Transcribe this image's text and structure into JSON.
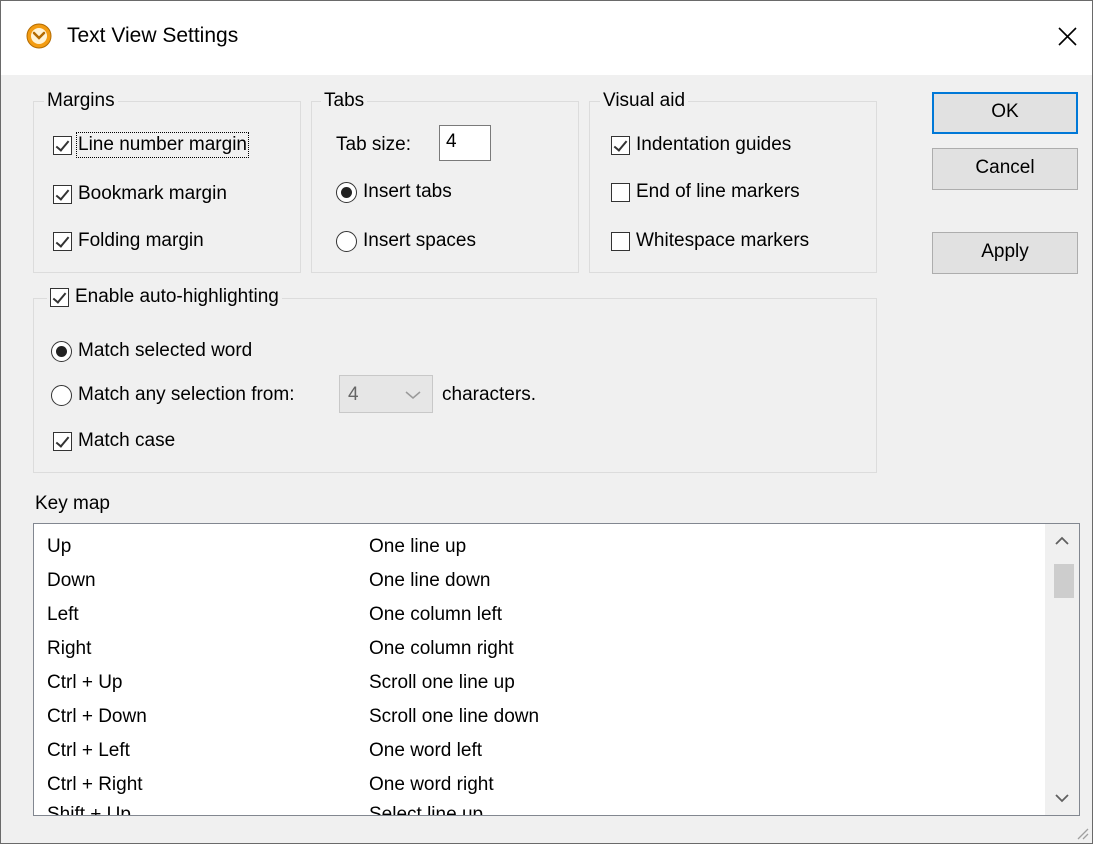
{
  "window": {
    "title": "Text View Settings",
    "accent_color": "#0078d7",
    "app_icon_color": "#f39c12"
  },
  "margins": {
    "legend": "Margins",
    "line_number": {
      "label": "Line number margin",
      "checked": true
    },
    "bookmark": {
      "label": "Bookmark margin",
      "checked": true
    },
    "folding": {
      "label": "Folding margin",
      "checked": true
    }
  },
  "tabs": {
    "legend": "Tabs",
    "tab_size_label": "Tab size:",
    "tab_size_value": "4",
    "insert_tabs": {
      "label": "Insert tabs",
      "selected": true
    },
    "insert_spaces": {
      "label": "Insert spaces",
      "selected": false
    }
  },
  "visual_aid": {
    "legend": "Visual aid",
    "indentation_guides": {
      "label": "Indentation guides",
      "checked": true
    },
    "end_of_line": {
      "label": "End of line markers",
      "checked": false
    },
    "whitespace": {
      "label": "Whitespace markers",
      "checked": false
    }
  },
  "buttons": {
    "ok": "OK",
    "cancel": "Cancel",
    "apply": "Apply"
  },
  "auto_highlighting": {
    "label": "Enable auto-highlighting",
    "checked": true,
    "match_selected_word": {
      "label": "Match selected word",
      "selected": true
    },
    "match_any_selection": {
      "label": "Match any selection from:",
      "selected": false
    },
    "min_chars": "4",
    "characters_label": "characters.",
    "match_case": {
      "label": "Match case",
      "checked": true
    }
  },
  "key_map": {
    "label": "Key map",
    "rows": [
      {
        "key": "Up",
        "action": "One line up"
      },
      {
        "key": "Down",
        "action": "One line down"
      },
      {
        "key": "Left",
        "action": "One column left"
      },
      {
        "key": "Right",
        "action": "One column right"
      },
      {
        "key": "Ctrl + Up",
        "action": "Scroll one line up"
      },
      {
        "key": "Ctrl + Down",
        "action": "Scroll one line down"
      },
      {
        "key": "Ctrl + Left",
        "action": "One word left"
      },
      {
        "key": "Ctrl + Right",
        "action": "One word right"
      },
      {
        "key": "Shift + Up",
        "action": "Select line up"
      }
    ]
  }
}
